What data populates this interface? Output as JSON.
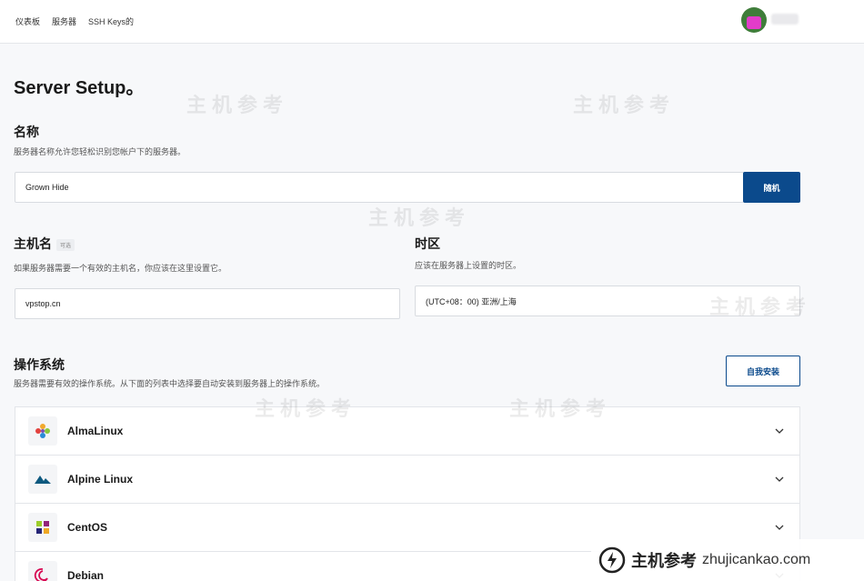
{
  "nav": {
    "items": [
      "仪表板",
      "服务器",
      "SSH Keys的"
    ]
  },
  "page": {
    "title": "Server Setup。"
  },
  "name_section": {
    "title": "名称",
    "description": "服务器名称允许您轻松识别您帐户下的服务器。",
    "value": "Grown Hide",
    "random_button": "随机"
  },
  "hostname_section": {
    "title": "主机名",
    "optional_badge": "可选",
    "description": "如果服务器需要一个有效的主机名，你应该在这里设置它。",
    "value": "vpstop.cn"
  },
  "timezone_section": {
    "title": "时区",
    "description": "应该在服务器上设置的时区。",
    "value": "(UTC+08：00) 亚洲/上海"
  },
  "os_section": {
    "title": "操作系统",
    "description": "服务器需要有效的操作系统。从下面的列表中选择要自动安装到服务器上的操作系统。",
    "self_install_button": "自我安装",
    "items": [
      {
        "name": "AlmaLinux",
        "icon": "almalinux-icon"
      },
      {
        "name": "Alpine Linux",
        "icon": "alpine-icon"
      },
      {
        "name": "CentOS",
        "icon": "centos-icon"
      },
      {
        "name": "Debian",
        "icon": "debian-icon"
      }
    ]
  },
  "watermark": {
    "text": "主机参考",
    "domain": "zhujicankao.com",
    "sub": "ZHUJICANKAO.COM"
  },
  "colors": {
    "primary": "#0b4a8c",
    "background": "#f7f8fa",
    "border": "#d8dbe0"
  }
}
